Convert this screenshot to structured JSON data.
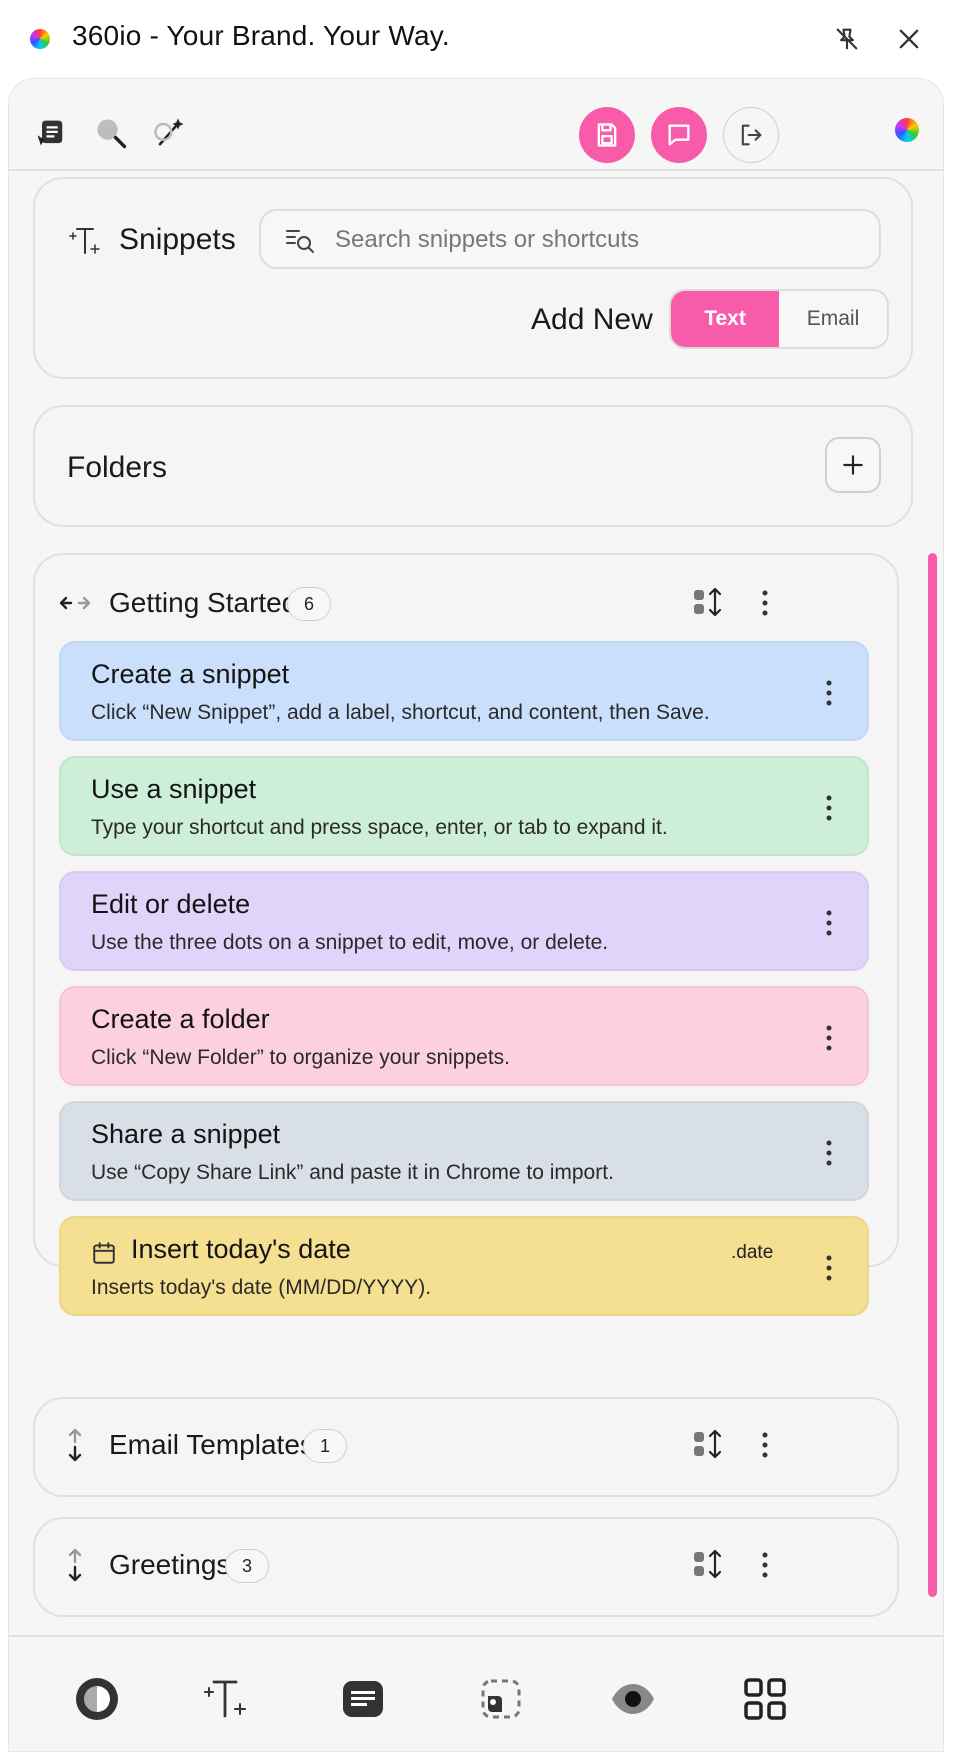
{
  "window": {
    "title": "360io - Your Brand. Your Way."
  },
  "colors": {
    "accent": "#f75ba9",
    "panel_bg": "#f6f6f6"
  },
  "toolbar": {
    "icons": [
      "snippets-list-icon",
      "search-icon",
      "magic-wand-icon"
    ],
    "buttons": [
      "save-button",
      "chat-button",
      "logout-button"
    ]
  },
  "snippets": {
    "title": "Snippets",
    "search_placeholder": "Search snippets or shortcuts",
    "add_new_label": "Add New",
    "type_options": [
      "Text",
      "Email"
    ],
    "selected_type": "Text"
  },
  "folders": {
    "title": "Folders"
  },
  "groups": [
    {
      "name": "Getting Started",
      "count": "6",
      "expanded": true,
      "items": [
        {
          "title": "Create a snippet",
          "description": "Click “New Snippet”, add a label, shortcut, and content, then Save.",
          "color": "#cadffb"
        },
        {
          "title": "Use a snippet",
          "description": "Type your shortcut and press space, enter, or tab to expand it.",
          "color": "#cdeed7"
        },
        {
          "title": "Edit or delete",
          "description": "Use the three dots on a snippet to edit, move, or delete.",
          "color": "#e0d4fb"
        },
        {
          "title": "Create a folder",
          "description": "Click “New Folder” to organize your snippets.",
          "color": "#fdd0e1"
        },
        {
          "title": "Share a snippet",
          "description": "Use “Copy Share Link” and paste it in Chrome to import.",
          "color": "#d8dfe7"
        },
        {
          "title": "Insert today's date",
          "description": "Inserts today's date (MM/DD/YYYY).",
          "shortcut": ".date",
          "color": "#f5df90"
        }
      ]
    },
    {
      "name": "Email Templates",
      "count": "1",
      "expanded": false
    },
    {
      "name": "Greetings",
      "count": "3",
      "expanded": false
    }
  ],
  "bottom_nav": [
    "theme-icon",
    "snippets-icon",
    "notes-icon",
    "screenshot-icon",
    "preview-eye-icon",
    "apps-grid-icon"
  ]
}
